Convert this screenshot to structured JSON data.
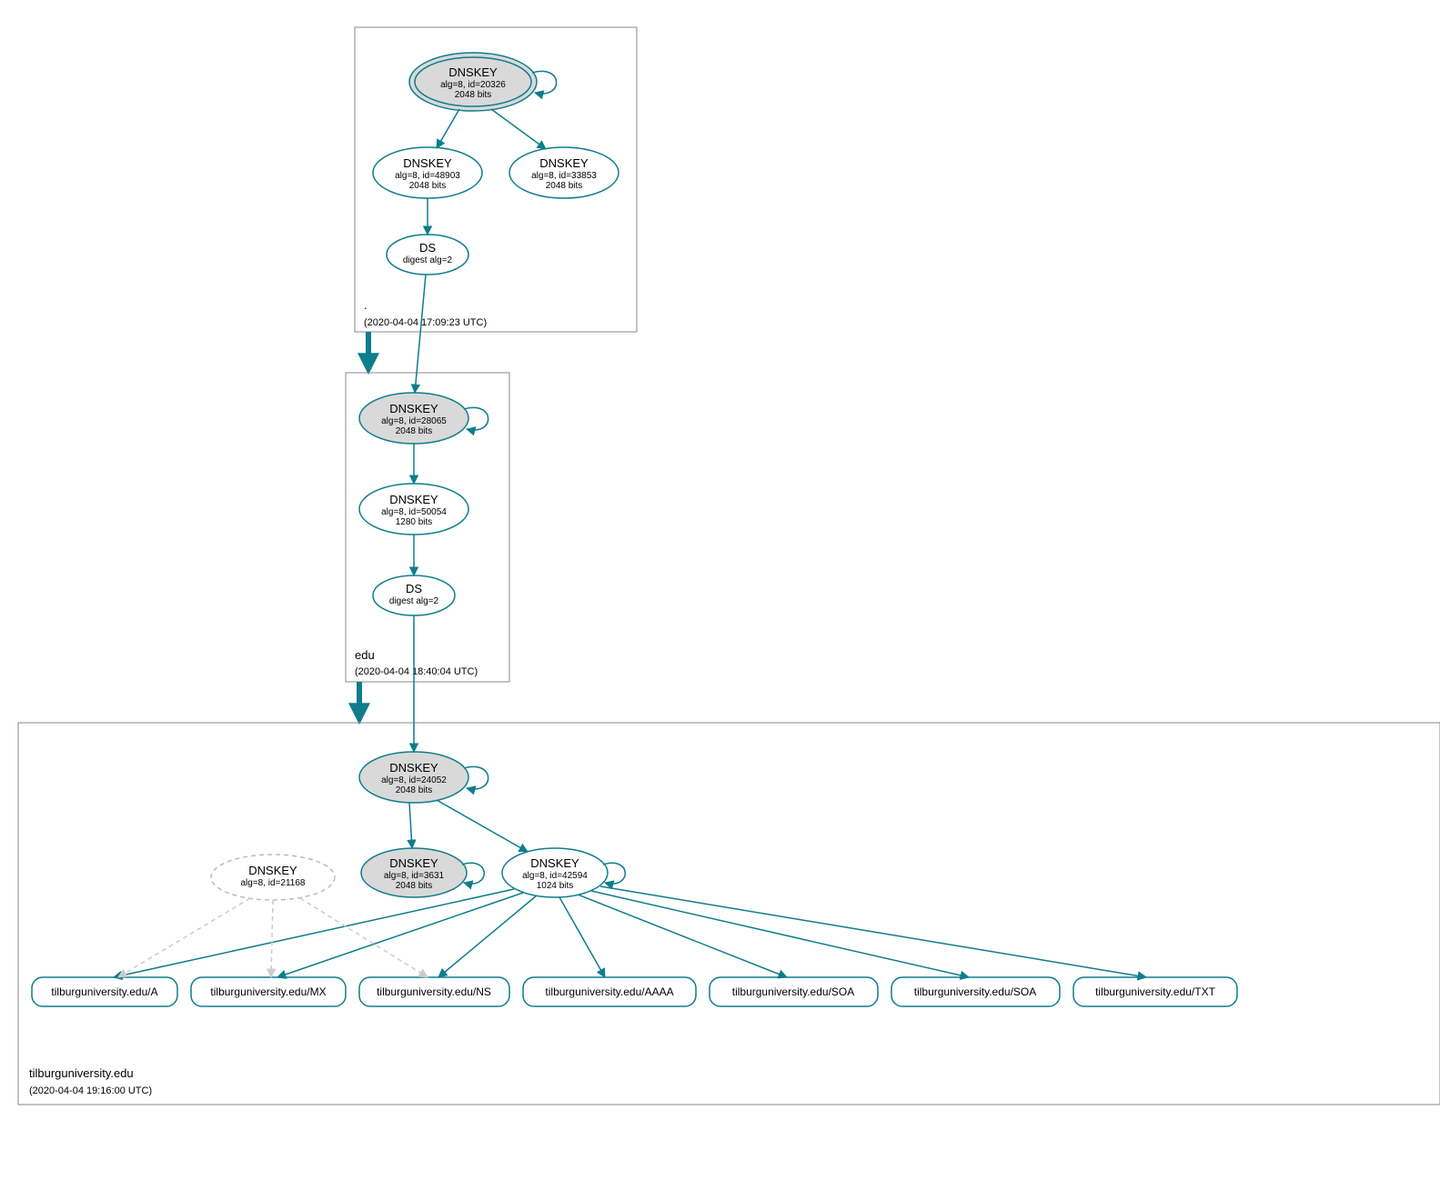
{
  "colors": {
    "primary": "#0e7d8c",
    "node_fill": "#d9d9d9",
    "muted": "#cccccc"
  },
  "zones": [
    {
      "name": ".",
      "timestamp": "(2020-04-04 17:09:23 UTC)",
      "nodes": [
        {
          "id": "root-ksk",
          "type": "DNSKEY",
          "label": "DNSKEY",
          "sub1": "alg=8, id=20326",
          "sub2": "2048 bits",
          "style": "filled-double",
          "selfloop": true
        },
        {
          "id": "root-zsk1",
          "type": "DNSKEY",
          "label": "DNSKEY",
          "sub1": "alg=8, id=48903",
          "sub2": "2048 bits",
          "style": "plain"
        },
        {
          "id": "root-zsk2",
          "type": "DNSKEY",
          "label": "DNSKEY",
          "sub1": "alg=8, id=33853",
          "sub2": "2048 bits",
          "style": "plain"
        },
        {
          "id": "root-ds",
          "type": "DS",
          "label": "DS",
          "sub1": "digest alg=2",
          "style": "plain"
        }
      ]
    },
    {
      "name": "edu",
      "timestamp": "(2020-04-04 18:40:04 UTC)",
      "nodes": [
        {
          "id": "edu-ksk",
          "type": "DNSKEY",
          "label": "DNSKEY",
          "sub1": "alg=8, id=28065",
          "sub2": "2048 bits",
          "style": "filled",
          "selfloop": true
        },
        {
          "id": "edu-zsk",
          "type": "DNSKEY",
          "label": "DNSKEY",
          "sub1": "alg=8, id=50054",
          "sub2": "1280 bits",
          "style": "plain"
        },
        {
          "id": "edu-ds",
          "type": "DS",
          "label": "DS",
          "sub1": "digest alg=2",
          "style": "plain"
        }
      ]
    },
    {
      "name": "tilburguniversity.edu",
      "timestamp": "(2020-04-04 19:16:00 UTC)",
      "nodes": [
        {
          "id": "tu-ksk",
          "type": "DNSKEY",
          "label": "DNSKEY",
          "sub1": "alg=8, id=24052",
          "sub2": "2048 bits",
          "style": "filled",
          "selfloop": true
        },
        {
          "id": "tu-zsk1",
          "type": "DNSKEY",
          "label": "DNSKEY",
          "sub1": "alg=8, id=3631",
          "sub2": "2048 bits",
          "style": "filled",
          "selfloop": true
        },
        {
          "id": "tu-zsk2",
          "type": "DNSKEY",
          "label": "DNSKEY",
          "sub1": "alg=8, id=42594",
          "sub2": "1024 bits",
          "style": "plain",
          "selfloop": true
        },
        {
          "id": "tu-old",
          "type": "DNSKEY",
          "label": "DNSKEY",
          "sub1": "alg=8, id=21168",
          "sub2": "",
          "style": "dashed"
        }
      ],
      "rrsets": [
        {
          "id": "rr-a",
          "label": "tilburguniversity.edu/A"
        },
        {
          "id": "rr-mx",
          "label": "tilburguniversity.edu/MX"
        },
        {
          "id": "rr-ns",
          "label": "tilburguniversity.edu/NS"
        },
        {
          "id": "rr-aaaa",
          "label": "tilburguniversity.edu/AAAA"
        },
        {
          "id": "rr-soa1",
          "label": "tilburguniversity.edu/SOA"
        },
        {
          "id": "rr-soa2",
          "label": "tilburguniversity.edu/SOA"
        },
        {
          "id": "rr-txt",
          "label": "tilburguniversity.edu/TXT"
        }
      ]
    }
  ],
  "edges": [
    {
      "from": "root-ksk",
      "to": "root-zsk1",
      "style": "solid"
    },
    {
      "from": "root-ksk",
      "to": "root-zsk2",
      "style": "solid"
    },
    {
      "from": "root-zsk1",
      "to": "root-ds",
      "style": "solid"
    },
    {
      "from": "root-ds",
      "to": "edu-ksk",
      "style": "solid"
    },
    {
      "from": "root-zone",
      "to": "edu-zone",
      "style": "thick"
    },
    {
      "from": "edu-ksk",
      "to": "edu-zsk",
      "style": "solid"
    },
    {
      "from": "edu-zsk",
      "to": "edu-ds",
      "style": "solid"
    },
    {
      "from": "edu-ds",
      "to": "tu-ksk",
      "style": "solid"
    },
    {
      "from": "edu-zone",
      "to": "tu-zone",
      "style": "thick"
    },
    {
      "from": "tu-ksk",
      "to": "tu-zsk1",
      "style": "solid"
    },
    {
      "from": "tu-ksk",
      "to": "tu-zsk2",
      "style": "solid"
    },
    {
      "from": "tu-zsk2",
      "to": "rr-a",
      "style": "solid"
    },
    {
      "from": "tu-zsk2",
      "to": "rr-mx",
      "style": "solid"
    },
    {
      "from": "tu-zsk2",
      "to": "rr-ns",
      "style": "solid"
    },
    {
      "from": "tu-zsk2",
      "to": "rr-aaaa",
      "style": "solid"
    },
    {
      "from": "tu-zsk2",
      "to": "rr-soa1",
      "style": "solid"
    },
    {
      "from": "tu-zsk2",
      "to": "rr-soa2",
      "style": "solid"
    },
    {
      "from": "tu-zsk2",
      "to": "rr-txt",
      "style": "solid"
    },
    {
      "from": "tu-old",
      "to": "rr-a",
      "style": "dashed"
    },
    {
      "from": "tu-old",
      "to": "rr-mx",
      "style": "dashed"
    },
    {
      "from": "tu-old",
      "to": "rr-ns",
      "style": "dashed"
    }
  ]
}
